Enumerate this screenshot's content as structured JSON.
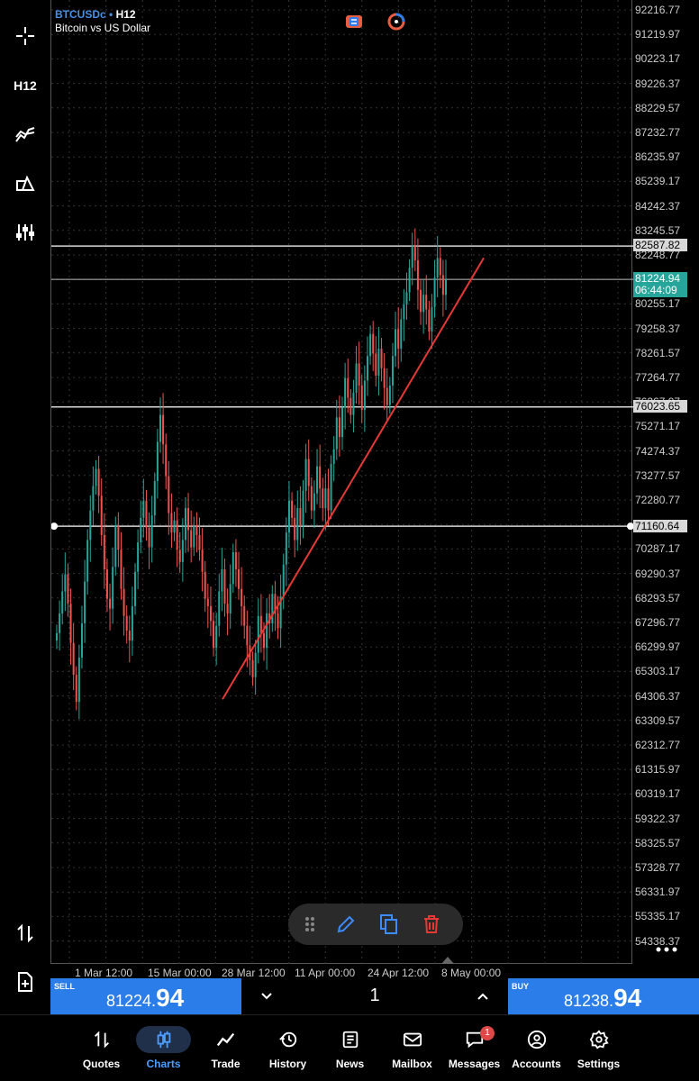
{
  "app": {
    "symbol": "BTCUSDc",
    "timeframe_sep": "•",
    "timeframe": "H12",
    "description": "Bitcoin vs US Dollar"
  },
  "toolbar": {
    "timeframe_label": "H12",
    "icons": [
      "crosshair-icon",
      "indicators-icon",
      "objects-icon",
      "settings-sliders-icon",
      "sort-arrows-icon",
      "new-document-icon"
    ]
  },
  "price_axis": [
    "92216.77",
    "91219.97",
    "90223.17",
    "89226.37",
    "88229.57",
    "87232.77",
    "86235.97",
    "85239.17",
    "84242.37",
    "83245.57",
    "82248.77",
    "81251.97",
    "80255.17",
    "79258.37",
    "78261.57",
    "77264.77",
    "76267.97",
    "75271.17",
    "74274.37",
    "73277.57",
    "72280.77",
    "71283.97",
    "70287.17",
    "69290.37",
    "68293.57",
    "67296.77",
    "66299.97",
    "65303.17",
    "64306.37",
    "63309.57",
    "62312.77",
    "61315.97",
    "60319.17",
    "59322.37",
    "58325.57",
    "57328.77",
    "56331.97",
    "55335.17",
    "54338.37"
  ],
  "horizontal_lines": [
    {
      "price": "82587.82",
      "value": 82587.82
    },
    {
      "price": "76023.65",
      "value": 76023.65
    },
    {
      "price": "71160.64",
      "value": 71160.64
    }
  ],
  "current": {
    "price": "81224.94",
    "countdown": "06:44:09",
    "value": 81224.94
  },
  "time_axis": [
    "1 Mar 12:00",
    "15 Mar 00:00",
    "28 Mar 12:00",
    "11 Apr 00:00",
    "24 Apr 12:00",
    "8 May 00:00"
  ],
  "trendline": {
    "from": [
      64100,
      "start"
    ],
    "to": [
      82100,
      "end"
    ]
  },
  "colors": {
    "up": "#26a69a",
    "down": "#ef5350",
    "trend": "#e53935",
    "accent": "#2b7de9"
  },
  "trade": {
    "sell_tag": "SELL",
    "sell_small": "81224.",
    "sell_big": "94",
    "volume": "1",
    "buy_tag": "BUY",
    "buy_small": "81238.",
    "buy_big": "94"
  },
  "nav": [
    {
      "label": "Quotes",
      "icon": "quotes-icon"
    },
    {
      "label": "Charts",
      "icon": "charts-icon",
      "active": true
    },
    {
      "label": "Trade",
      "icon": "trade-icon"
    },
    {
      "label": "History",
      "icon": "history-icon"
    },
    {
      "label": "News",
      "icon": "news-icon"
    },
    {
      "label": "Mailbox",
      "icon": "mailbox-icon"
    },
    {
      "label": "Messages",
      "icon": "messages-icon",
      "badge": "1"
    },
    {
      "label": "Accounts",
      "icon": "accounts-icon"
    },
    {
      "label": "Settings",
      "icon": "settings-icon"
    }
  ],
  "chart_data": {
    "type": "candlestick",
    "x": [
      "1 Mar 12:00",
      "15 Mar 00:00",
      "28 Mar 12:00",
      "11 Apr 00:00",
      "24 Apr 12:00",
      "8 May 00:00"
    ],
    "ylim": [
      54338.37,
      92216.77
    ],
    "series": [
      {
        "close": [
          66800,
          67600,
          68500,
          69200,
          68000,
          66400,
          65100,
          64000,
          65800,
          67200,
          68900,
          70600,
          71800,
          72800,
          73500,
          72400,
          70800,
          69400,
          68200,
          67800,
          69500,
          71200,
          70200,
          68600,
          67500,
          66900,
          66500,
          67900,
          69300,
          70500,
          71500,
          72200,
          71100,
          70300,
          71600,
          73000,
          74600,
          75700,
          74500,
          73200,
          71700,
          70900,
          71400,
          70200,
          69700,
          70600,
          71900,
          71000,
          70300,
          71200,
          70800,
          70200,
          69300,
          68200,
          67900,
          67300,
          66200,
          67100,
          68500,
          69400,
          68000,
          67600,
          68800,
          70100,
          69400,
          68600,
          67900,
          67100,
          66300,
          65700,
          65000,
          66000,
          67500,
          66800,
          66200,
          67600,
          67200,
          68400,
          67600,
          67000,
          68300,
          69600,
          70900,
          72200,
          71500,
          70600,
          71900,
          71200,
          72600,
          73900,
          72800,
          71800,
          72500,
          73600,
          72700,
          71900,
          72700,
          71800,
          73700,
          74300,
          75600,
          74800,
          76000,
          77200,
          76400,
          75700,
          76600,
          77800,
          76900,
          75900,
          77100,
          78100,
          79000,
          78200,
          77300,
          78400,
          77600,
          76800,
          76100,
          76900,
          78100,
          79200,
          78400,
          79600,
          80200,
          80700,
          81700,
          82600,
          82000,
          80800,
          79900,
          80600,
          80000,
          79100,
          80100,
          81300,
          82100,
          81400,
          80600,
          81224.94
        ]
      }
    ],
    "horizontal_lines": [
      82587.82,
      76023.65,
      71160.64
    ],
    "current_price": 81224.94
  }
}
